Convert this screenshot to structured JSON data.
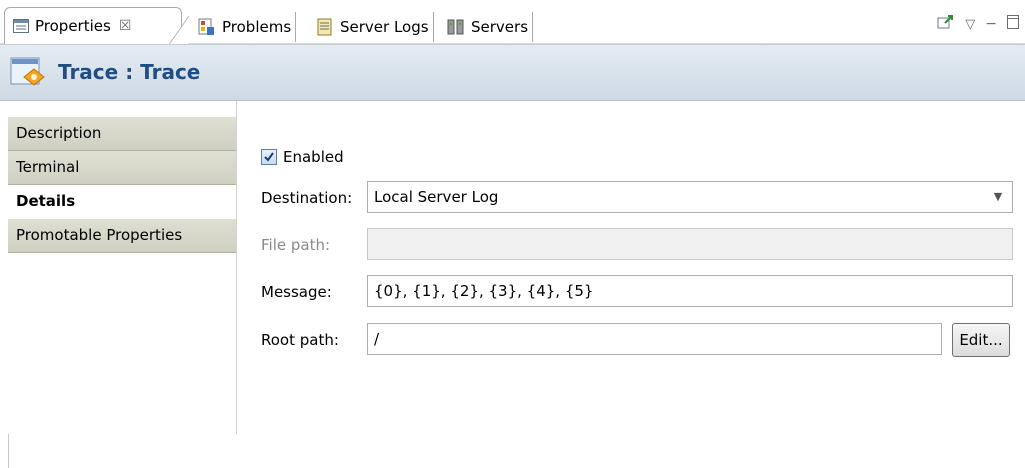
{
  "tabs": {
    "properties": {
      "label": "Properties",
      "close": "☒"
    },
    "problems": {
      "label": "Problems"
    },
    "server_logs": {
      "label": "Server Logs"
    },
    "servers": {
      "label": "Servers"
    }
  },
  "view_toolbar": {
    "icons": [
      "pin-icon",
      "view-menu-icon",
      "minimize-icon",
      "maximize-icon"
    ],
    "menu_glyph": "▽",
    "minimize_glyph": "−"
  },
  "title": {
    "text": "Trace : Trace",
    "color": "#1f4e84"
  },
  "nav": {
    "items": [
      {
        "label": "Description"
      },
      {
        "label": "Terminal"
      },
      {
        "label": "Details"
      },
      {
        "label": "Promotable Properties"
      }
    ],
    "selected": "Details"
  },
  "form": {
    "enabled": {
      "label": "Enabled",
      "checked": true
    },
    "destination": {
      "label": "Destination:",
      "value": "Local Server Log"
    },
    "file_path": {
      "label": "File path:",
      "value": ""
    },
    "message": {
      "label": "Message:",
      "value": "{0}, {1}, {2}, {3}, {4}, {5}"
    },
    "root_path": {
      "label": "Root path:",
      "value": "/"
    },
    "edit_button": "Edit..."
  }
}
